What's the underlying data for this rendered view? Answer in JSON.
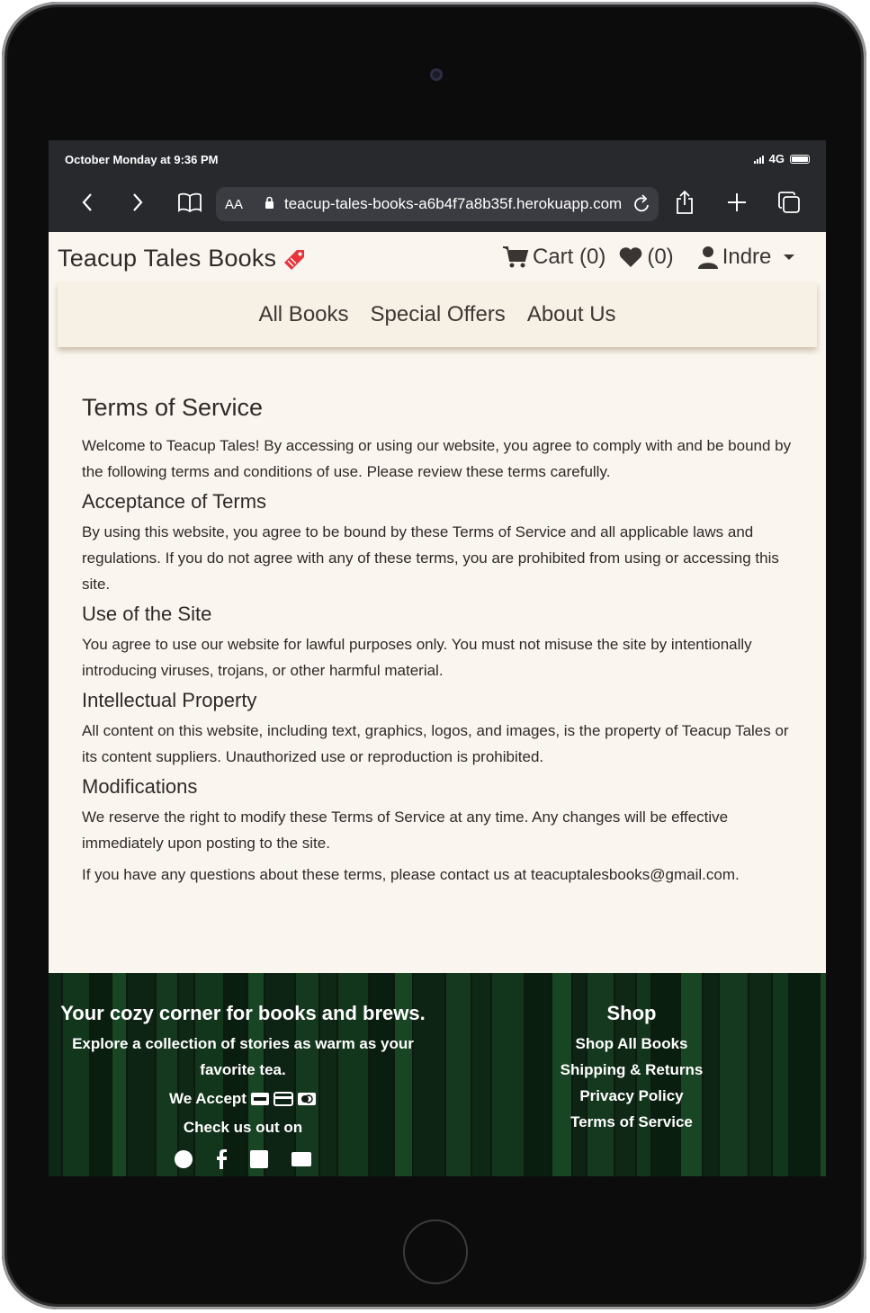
{
  "status_bar": {
    "time": "October Monday at 9:36 PM",
    "network": "4G"
  },
  "browser": {
    "text_size_label": "AA",
    "url": "teacup-tales-books-a6b4f7a8b35f.herokuapp.com"
  },
  "header": {
    "brand": "Teacup Tales Books",
    "cart_label": "Cart (0)",
    "wishlist_label": "(0)",
    "user_label": "Indre"
  },
  "nav": {
    "items": [
      "All Books",
      "Special Offers",
      "About Us"
    ]
  },
  "content": {
    "title": "Terms of Service",
    "intro": "Welcome to Teacup Tales! By accessing or using our website, you agree to comply with and be bound by the following terms and conditions of use. Please review these terms carefully.",
    "sections": [
      {
        "heading": "Acceptance of Terms",
        "body": "By using this website, you agree to be bound by these Terms of Service and all applicable laws and regulations. If you do not agree with any of these terms, you are prohibited from using or accessing this site."
      },
      {
        "heading": "Use of the Site",
        "body": "You agree to use our website for lawful purposes only. You must not misuse the site by intentionally introducing viruses, trojans, or other harmful material."
      },
      {
        "heading": "Intellectual Property",
        "body": "All content on this website, including text, graphics, logos, and images, is the property of Teacup Tales or its content suppliers. Unauthorized use or reproduction is prohibited."
      },
      {
        "heading": "Modifications",
        "body": "We reserve the right to modify these Terms of Service at any time. Any changes will be effective immediately upon posting to the site."
      }
    ],
    "contact": "If you have any questions about these terms, please contact us at teacuptalesbooks@gmail.com."
  },
  "footer": {
    "tagline": "Your cozy corner for books and brews.",
    "subtitle": "Explore a collection of stories as warm as your favorite tea.",
    "accept_label": "We Accept",
    "check_label": "Check us out on",
    "shop_heading": "Shop",
    "shop_links": [
      "Shop All Books",
      "Shipping & Returns",
      "Privacy Policy",
      "Terms of Service"
    ]
  },
  "colors": {
    "page_bg": "#faf5ee",
    "nav_bg": "#f7f0e4",
    "footer_bg": "#0c1a10",
    "brand_accent": "#e8343b",
    "browser_chrome": "#28292d"
  }
}
